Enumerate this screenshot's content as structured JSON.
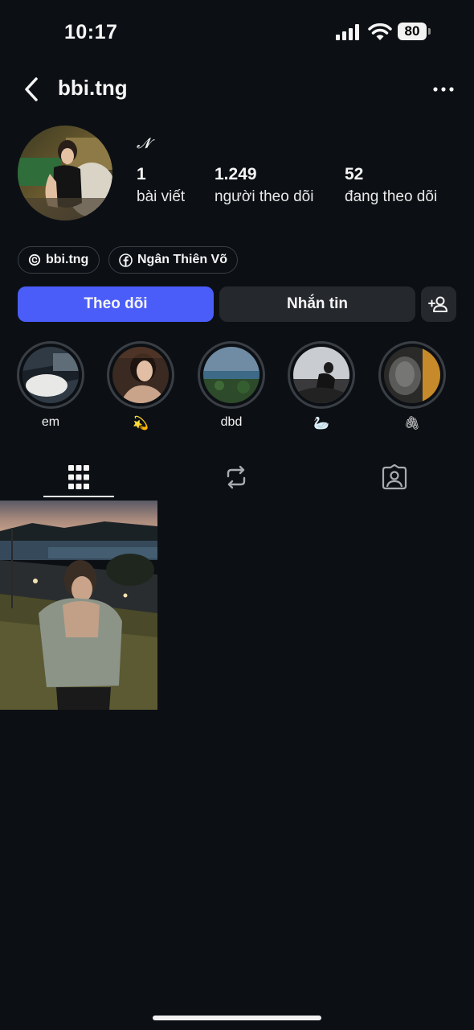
{
  "status_bar": {
    "time": "10:17",
    "battery": "80"
  },
  "header": {
    "username": "bbi.tng"
  },
  "profile": {
    "display_name": "𝓝",
    "stats": [
      {
        "value": "1",
        "label": "bài viết"
      },
      {
        "value": "1.249",
        "label": "người theo dõi"
      },
      {
        "value": "52",
        "label": "đang theo dõi"
      }
    ]
  },
  "links": [
    {
      "icon": "threads-icon",
      "label": "bbi.tng"
    },
    {
      "icon": "facebook-icon",
      "label": "Ngân Thiên Võ"
    }
  ],
  "actions": {
    "follow": "Theo dõi",
    "message": "Nhắn tin"
  },
  "highlights": [
    {
      "label": "em"
    },
    {
      "label": "💫"
    },
    {
      "label": "dbd"
    },
    {
      "label": "🦢"
    },
    {
      "label": "🖇"
    }
  ],
  "tabs": [
    {
      "icon": "grid-icon"
    },
    {
      "icon": "reposts-icon"
    },
    {
      "icon": "tagged-icon"
    }
  ],
  "colors": {
    "background": "#0c1014",
    "follow_button": "#4a5df9",
    "secondary_button": "#25292e"
  }
}
